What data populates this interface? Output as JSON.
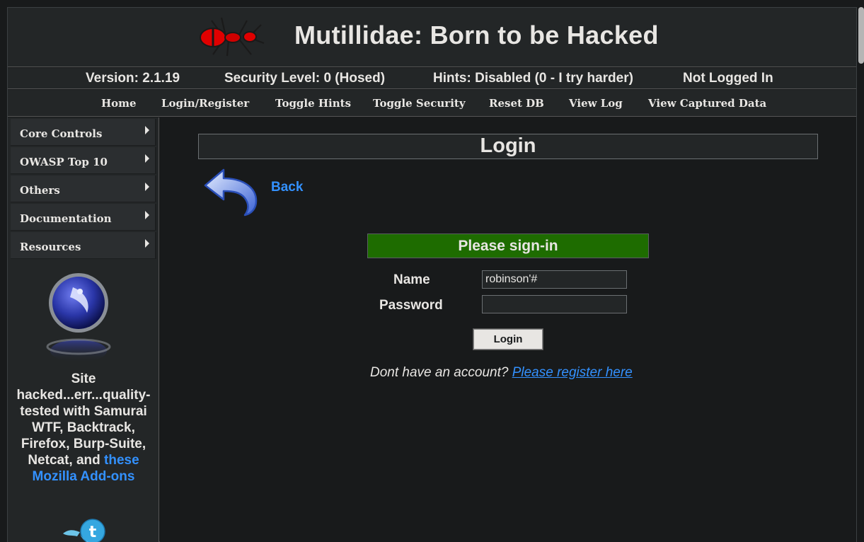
{
  "header": {
    "title": "Mutillidae: Born to be Hacked"
  },
  "status_bar": {
    "version": "Version: 2.1.19",
    "security_level": "Security Level: 0 (Hosed)",
    "hints": "Hints: Disabled (0 - I try harder)",
    "login_status": "Not Logged In"
  },
  "menu": {
    "items": [
      {
        "label": "Home"
      },
      {
        "label": "Login/Register"
      },
      {
        "label": "Toggle Hints"
      },
      {
        "label": "Toggle Security"
      },
      {
        "label": "Reset DB"
      },
      {
        "label": "View Log"
      },
      {
        "label": "View Captured Data"
      }
    ]
  },
  "sidebar": {
    "items": [
      {
        "label": "Core Controls"
      },
      {
        "label": "OWASP Top 10"
      },
      {
        "label": "Others"
      },
      {
        "label": "Documentation"
      },
      {
        "label": "Resources"
      }
    ],
    "credits_text": "Site hacked...err...quality-tested with Samurai WTF, Backtrack, Firefox, Burp-Suite, Netcat, and",
    "credits_link": "these Mozilla Add-ons"
  },
  "main": {
    "page_title": "Login",
    "back_label": "Back",
    "form": {
      "header": "Please sign-in",
      "name_label": "Name",
      "name_value": "robinson'#",
      "password_label": "Password",
      "password_value": "",
      "submit_label": "Login"
    },
    "register_prompt": "Dont have an account?",
    "register_link": "Please register here"
  },
  "colors": {
    "background": "#181a1b",
    "panel": "#232627",
    "link": "#3391ff",
    "signin_header": "#1e6c00"
  },
  "icons": [
    "ant-logo-icon",
    "back-arrow-icon",
    "owasp-logo-icon",
    "twitter-bird-icon",
    "chevron-right-icon"
  ]
}
